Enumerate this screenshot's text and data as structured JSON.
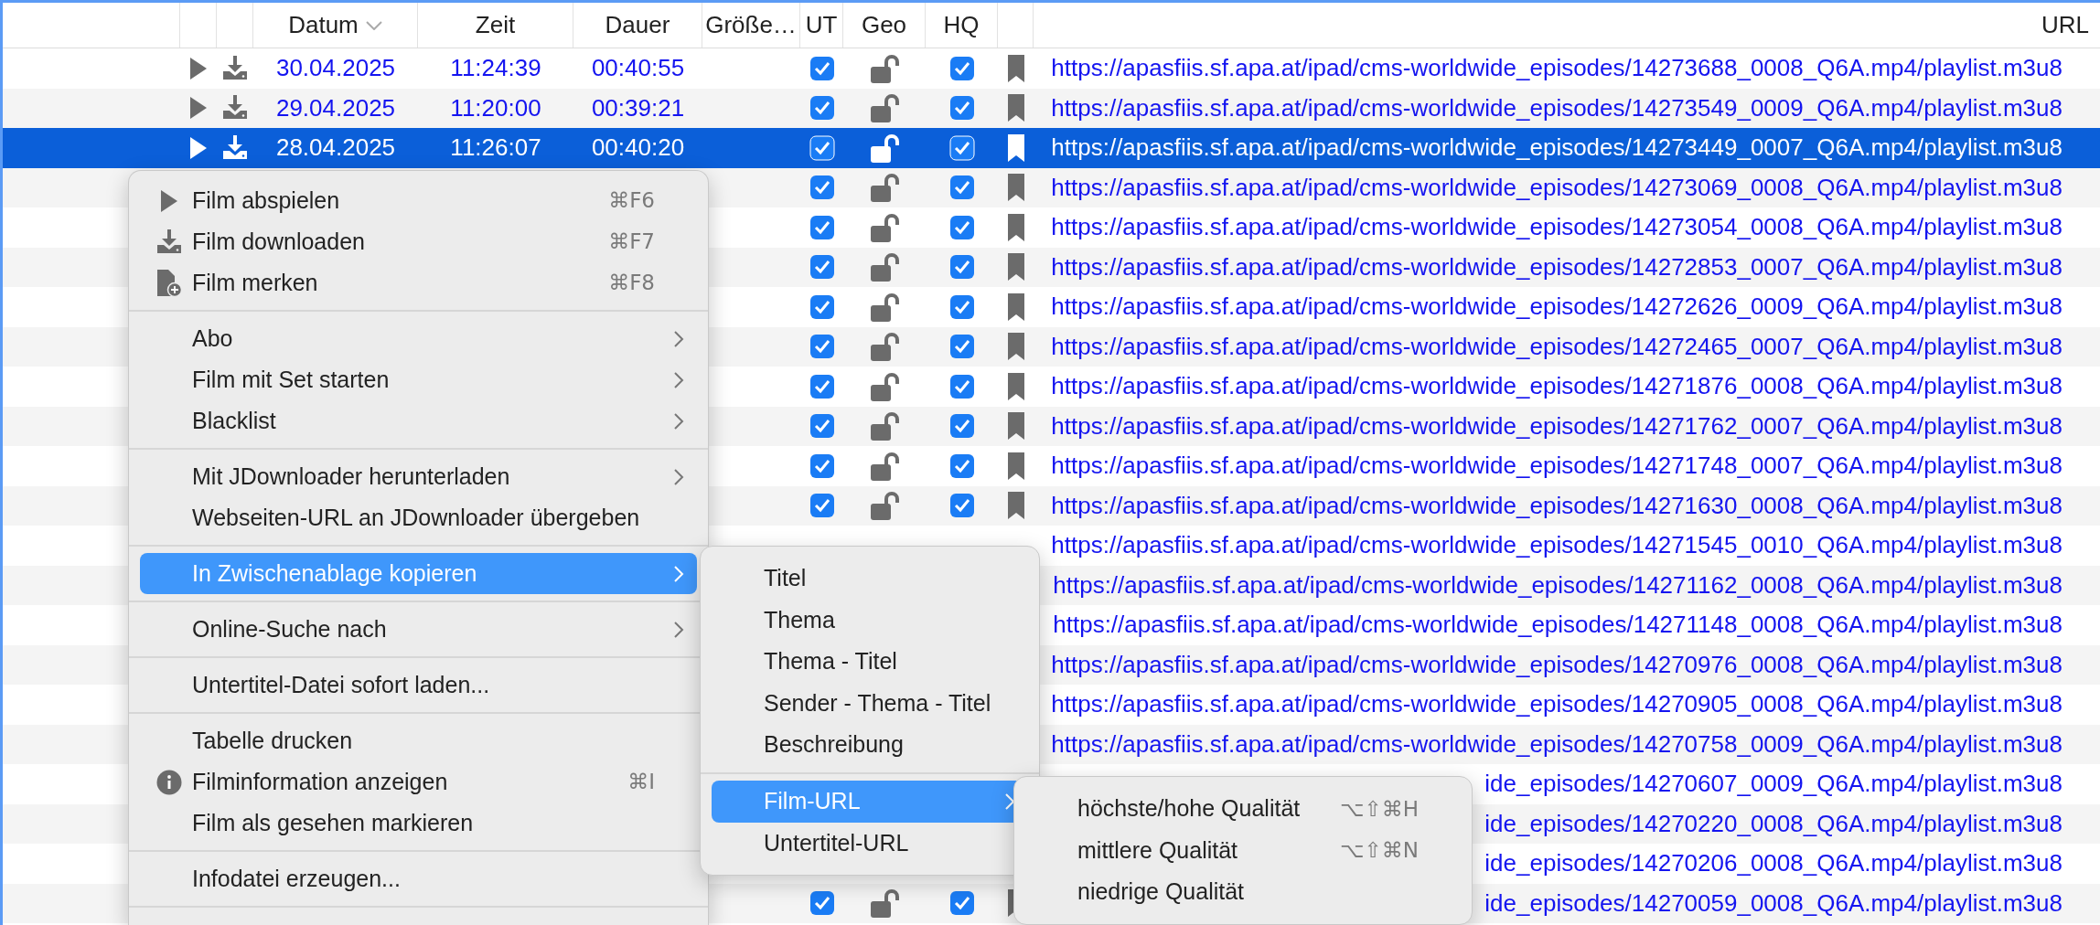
{
  "table": {
    "columns": [
      {
        "label": "Datum",
        "sorted": true
      },
      {
        "label": "Zeit"
      },
      {
        "label": "Dauer"
      },
      {
        "label": "Größe…"
      },
      {
        "label": "UT"
      },
      {
        "label": "Geo"
      },
      {
        "label": "HQ"
      },
      {
        "label": "URL"
      }
    ],
    "rows": [
      {
        "selected": false,
        "date": "30.04.2025",
        "time": "11:24:39",
        "duration": "00:40:55",
        "ut": true,
        "geo_locked": false,
        "hq": true,
        "url": "https://apasfiis.sf.apa.at/ipad/cms-worldwide_episodes/14273688_0008_Q6A.mp4/playlist.m3u8"
      },
      {
        "selected": false,
        "date": "29.04.2025",
        "time": "11:20:00",
        "duration": "00:39:21",
        "ut": true,
        "geo_locked": false,
        "hq": true,
        "url": "https://apasfiis.sf.apa.at/ipad/cms-worldwide_episodes/14273549_0009_Q6A.mp4/playlist.m3u8"
      },
      {
        "selected": true,
        "date": "28.04.2025",
        "time": "11:26:07",
        "duration": "00:40:20",
        "ut": true,
        "geo_locked": false,
        "hq": true,
        "url": "https://apasfiis.sf.apa.at/ipad/cms-worldwide_episodes/14273449_0007_Q6A.mp4/playlist.m3u8"
      },
      {
        "selected": false,
        "ut": true,
        "geo_locked": false,
        "hq": true,
        "url": "https://apasfiis.sf.apa.at/ipad/cms-worldwide_episodes/14273069_0008_Q6A.mp4/playlist.m3u8"
      },
      {
        "selected": false,
        "ut": true,
        "geo_locked": false,
        "hq": true,
        "url": "https://apasfiis.sf.apa.at/ipad/cms-worldwide_episodes/14273054_0008_Q6A.mp4/playlist.m3u8"
      },
      {
        "selected": false,
        "ut": true,
        "geo_locked": false,
        "hq": true,
        "url": "https://apasfiis.sf.apa.at/ipad/cms-worldwide_episodes/14272853_0007_Q6A.mp4/playlist.m3u8"
      },
      {
        "selected": false,
        "ut": true,
        "geo_locked": false,
        "hq": true,
        "url": "https://apasfiis.sf.apa.at/ipad/cms-worldwide_episodes/14272626_0009_Q6A.mp4/playlist.m3u8"
      },
      {
        "selected": false,
        "ut": true,
        "geo_locked": false,
        "hq": true,
        "url": "https://apasfiis.sf.apa.at/ipad/cms-worldwide_episodes/14272465_0007_Q6A.mp4/playlist.m3u8"
      },
      {
        "selected": false,
        "ut": true,
        "geo_locked": false,
        "hq": true,
        "url": "https://apasfiis.sf.apa.at/ipad/cms-worldwide_episodes/14271876_0008_Q6A.mp4/playlist.m3u8"
      },
      {
        "selected": false,
        "ut": true,
        "geo_locked": false,
        "hq": true,
        "url": "https://apasfiis.sf.apa.at/ipad/cms-worldwide_episodes/14271762_0007_Q6A.mp4/playlist.m3u8"
      },
      {
        "selected": false,
        "ut": true,
        "geo_locked": false,
        "hq": true,
        "url": "https://apasfiis.sf.apa.at/ipad/cms-worldwide_episodes/14271748_0007_Q6A.mp4/playlist.m3u8"
      },
      {
        "selected": false,
        "ut": true,
        "geo_locked": false,
        "hq": true,
        "url": "https://apasfiis.sf.apa.at/ipad/cms-worldwide_episodes/14271630_0008_Q6A.mp4/playlist.m3u8"
      },
      {
        "selected": false,
        "url": "https://apasfiis.sf.apa.at/ipad/cms-worldwide_episodes/14271545_0010_Q6A.mp4/playlist.m3u8"
      },
      {
        "selected": false,
        "url": "https://apasfiis.sf.apa.at/ipad/cms-worldwide_episodes/14271162_0008_Q6A.mp4/playlist.m3u8"
      },
      {
        "selected": false,
        "url": "https://apasfiis.sf.apa.at/ipad/cms-worldwide_episodes/14271148_0008_Q6A.mp4/playlist.m3u8"
      },
      {
        "selected": false,
        "url": "https://apasfiis.sf.apa.at/ipad/cms-worldwide_episodes/14270976_0008_Q6A.mp4/playlist.m3u8"
      },
      {
        "selected": false,
        "url": "https://apasfiis.sf.apa.at/ipad/cms-worldwide_episodes/14270905_0008_Q6A.mp4/playlist.m3u8"
      },
      {
        "selected": false,
        "url": "https://apasfiis.sf.apa.at/ipad/cms-worldwide_episodes/14270758_0009_Q6A.mp4/playlist.m3u8"
      },
      {
        "selected": false,
        "url": "ide_episodes/14270607_0009_Q6A.mp4/playlist.m3u8"
      },
      {
        "selected": false,
        "url": "ide_episodes/14270220_0008_Q6A.mp4/playlist.m3u8"
      },
      {
        "selected": false,
        "url": "ide_episodes/14270206_0008_Q6A.mp4/playlist.m3u8"
      },
      {
        "selected": false,
        "ut": true,
        "geo_locked": false,
        "hq": true,
        "url": "ide_episodes/14270059_0008_Q6A.mp4/playlist.m3u8"
      }
    ]
  },
  "context_menu": {
    "items": [
      {
        "kind": "item",
        "label": "Film abspielen",
        "shortcut": "⌘F6",
        "selected": false
      },
      {
        "kind": "item",
        "label": "Film downloaden",
        "shortcut": "⌘F7",
        "selected": false
      },
      {
        "kind": "item",
        "label": "Film merken",
        "shortcut": "⌘F8",
        "selected": false
      },
      {
        "kind": "separator"
      },
      {
        "kind": "item",
        "label": "Abo",
        "submenu": true,
        "selected": false
      },
      {
        "kind": "item",
        "label": "Film mit Set starten",
        "submenu": true,
        "selected": false
      },
      {
        "kind": "item",
        "label": "Blacklist",
        "submenu": true,
        "selected": false
      },
      {
        "kind": "separator"
      },
      {
        "kind": "item",
        "label": "Mit JDownloader herunterladen",
        "submenu": true,
        "selected": false
      },
      {
        "kind": "item",
        "label": "Webseiten-URL an JDownloader übergeben",
        "selected": false
      },
      {
        "kind": "separator"
      },
      {
        "kind": "item",
        "label": "In Zwischenablage kopieren",
        "submenu": true,
        "selected": true
      },
      {
        "kind": "separator"
      },
      {
        "kind": "item",
        "label": "Online-Suche nach",
        "submenu": true,
        "selected": false
      },
      {
        "kind": "separator"
      },
      {
        "kind": "item",
        "label": "Untertitel-Datei sofort laden...",
        "selected": false
      },
      {
        "kind": "separator"
      },
      {
        "kind": "item",
        "label": "Tabelle drucken",
        "selected": false
      },
      {
        "kind": "item",
        "label": "Filminformation anzeigen",
        "shortcut": "⌘I",
        "selected": false
      },
      {
        "kind": "item",
        "label": "Film als gesehen markieren",
        "selected": false
      },
      {
        "kind": "separator"
      },
      {
        "kind": "item",
        "label": "Infodatei erzeugen...",
        "selected": false
      },
      {
        "kind": "separator"
      }
    ]
  },
  "copy_submenu": {
    "items": [
      {
        "kind": "item",
        "label": "Titel",
        "selected": false
      },
      {
        "kind": "item",
        "label": "Thema",
        "selected": false
      },
      {
        "kind": "item",
        "label": "Thema - Titel",
        "selected": false
      },
      {
        "kind": "item",
        "label": "Sender - Thema - Titel",
        "selected": false
      },
      {
        "kind": "item",
        "label": "Beschreibung",
        "selected": false
      },
      {
        "kind": "separator"
      },
      {
        "kind": "item",
        "label": "Film-URL",
        "submenu": true,
        "selected": true
      },
      {
        "kind": "item",
        "label": "Untertitel-URL",
        "selected": false
      }
    ]
  },
  "film_url_submenu": {
    "items": [
      {
        "kind": "item",
        "label": "höchste/hohe Qualität",
        "shortcut": "⌥⇧⌘H",
        "selected": false
      },
      {
        "kind": "item",
        "label": "mittlere Qualität",
        "shortcut": "⌥⇧⌘N",
        "selected": false
      },
      {
        "kind": "item",
        "label": "niedrige Qualität",
        "selected": false
      }
    ]
  }
}
